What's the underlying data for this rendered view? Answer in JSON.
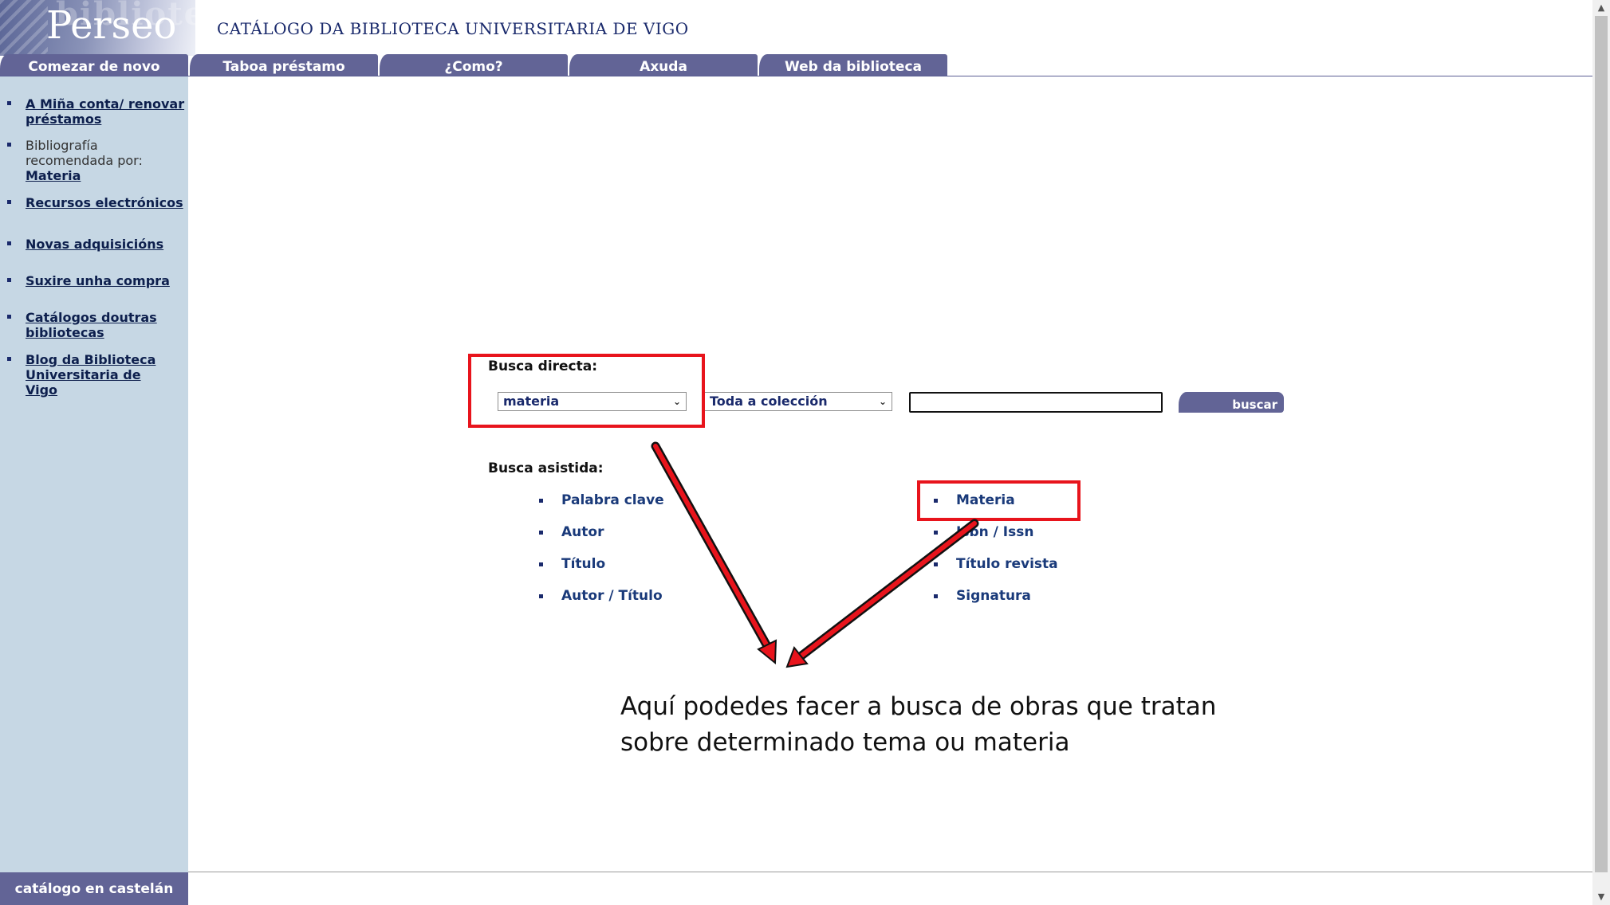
{
  "header": {
    "logo_text": "Perseo",
    "logo_watermark": "biblioteca",
    "catalog_title": "CATÁLOGO DA BIBLIOTECA UNIVERSITARIA DE VIGO"
  },
  "tabs": [
    {
      "label": "Comezar de novo"
    },
    {
      "label": "Taboa préstamo"
    },
    {
      "label": "¿Como?"
    },
    {
      "label": "Axuda"
    },
    {
      "label": "Web da biblioteca"
    }
  ],
  "sidebar": {
    "items": [
      {
        "link": "A Miña conta/ renovar préstamos"
      },
      {
        "text": "Bibliografía recomendada por:",
        "link": "Materia"
      },
      {
        "link": "Recursos electrónicos"
      },
      {
        "link": "Novas adquisicións"
      },
      {
        "link": "Suxire unha compra"
      },
      {
        "link": "Catálogos doutras bibliotecas"
      },
      {
        "link": "Blog da Biblioteca Universitaria de Vigo"
      }
    ],
    "footer_language": "catálogo en castelán"
  },
  "direct_search": {
    "label": "Busca directa:",
    "field_select": "materia",
    "collection_select": "Toda a colección",
    "query": "",
    "button": "buscar"
  },
  "assisted_search": {
    "label": "Busca asistida:",
    "left_options": [
      "Palabra clave",
      "Autor",
      "Título",
      "Autor / Título"
    ],
    "right_options": [
      "Materia",
      "Isbn / Issn",
      "Título revista",
      "Signatura"
    ]
  },
  "annotation": {
    "text": "Aquí podedes facer a busca de obras que tratan sobre determinado tema ou materia",
    "highlight_color": "#e8141c"
  },
  "colors": {
    "tab_background": "#626496",
    "sidebar_background": "#c6d7e4",
    "link": "#1a3a7a"
  }
}
